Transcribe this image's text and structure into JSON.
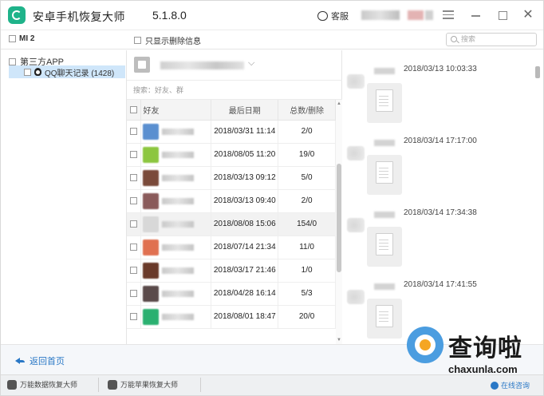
{
  "titlebar": {
    "app_title": "安卓手机恢复大师",
    "version": "5.1.8.0",
    "service_label": "客服"
  },
  "toolbar": {
    "device_label": "MI 2",
    "only_deleted_label": "只显示删除信息",
    "search_placeholder": "搜索"
  },
  "tree": {
    "root_label": "第三方APP",
    "child_label": "QQ聊天记录 (1428)"
  },
  "contacts": {
    "search_placeholder": "搜索：好友、群",
    "columns": {
      "friend": "好友",
      "date": "最后日期",
      "count": "总数/删除"
    },
    "rows": [
      {
        "date": "2018/03/31 11:14",
        "count": "2/0",
        "avatar_color": "#5a8fd0"
      },
      {
        "date": "2018/08/05 11:20",
        "count": "19/0",
        "avatar_color": "#8cc63f"
      },
      {
        "date": "2018/03/13 09:12",
        "count": "5/0",
        "avatar_color": "#7a4a3a"
      },
      {
        "date": "2018/03/13 09:40",
        "count": "2/0",
        "avatar_color": "#8a5a5a"
      },
      {
        "date": "2018/08/08 15:06",
        "count": "154/0",
        "avatar_color": "#d8d8d8"
      },
      {
        "date": "2018/07/14 21:34",
        "count": "11/0",
        "avatar_color": "#e07050"
      },
      {
        "date": "2018/03/17 21:46",
        "count": "1/0",
        "avatar_color": "#6a3a2a"
      },
      {
        "date": "2018/04/28 16:14",
        "count": "5/3",
        "avatar_color": "#5a4a4a"
      },
      {
        "date": "2018/08/01 18:47",
        "count": "20/0",
        "avatar_color": "#2ab070"
      }
    ]
  },
  "chat": {
    "messages": [
      {
        "time": "2018/03/13 10:03:33"
      },
      {
        "time": "2018/03/14 17:17:00"
      },
      {
        "time": "2018/03/14 17:34:38"
      },
      {
        "time": "2018/03/14 17:41:55"
      }
    ]
  },
  "backbar": {
    "back_label": "返回首页"
  },
  "statusbar": {
    "item1": "万能数据恢复大师",
    "item2": "万能苹果恢复大师",
    "online": "在线咨询"
  },
  "watermark": {
    "cn": "查询啦",
    "en": "chaxunla.com"
  }
}
